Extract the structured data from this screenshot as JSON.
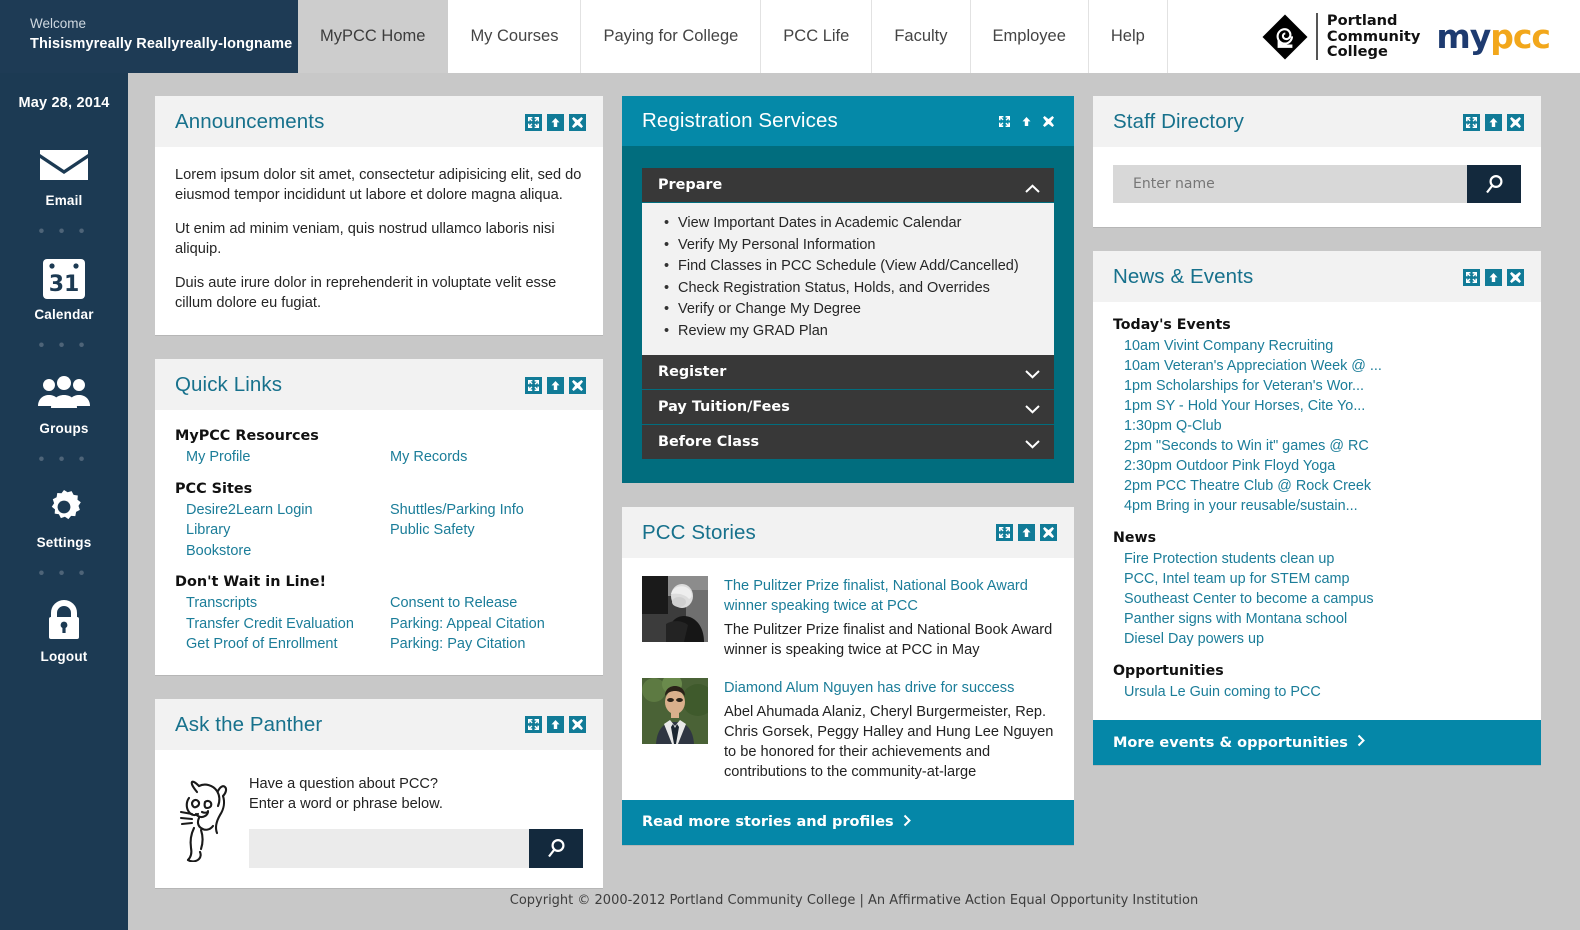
{
  "header": {
    "welcome_label": "Welcome",
    "user_name": "Thisismyreally Reallyreally-longname",
    "tabs": [
      {
        "label": "MyPCC Home",
        "active": true
      },
      {
        "label": "My Courses",
        "active": false
      },
      {
        "label": "Paying for College",
        "active": false
      },
      {
        "label": "PCC Life",
        "active": false
      },
      {
        "label": "Faculty",
        "active": false
      },
      {
        "label": "Employee",
        "active": false
      },
      {
        "label": "Help",
        "active": false
      }
    ],
    "logo": {
      "institution_line1": "Portland",
      "institution_line2": "Community",
      "institution_line3": "College",
      "wordmark_my": "my",
      "wordmark_pcc": "pcc"
    }
  },
  "sidebar": {
    "date": "May 28, 2014",
    "separator": "• • •",
    "items": [
      {
        "label": "Email",
        "icon": "envelope-icon"
      },
      {
        "label": "Calendar",
        "icon": "calendar-icon",
        "day": "31"
      },
      {
        "label": "Groups",
        "icon": "people-icon"
      },
      {
        "label": "Settings",
        "icon": "gear-icon"
      },
      {
        "label": "Logout",
        "icon": "lock-icon"
      }
    ]
  },
  "portlet_icons": {
    "expand": "expand-arrows-icon",
    "collapse": "up-arrow-icon",
    "close": "close-x-icon"
  },
  "announcements": {
    "title": "Announcements",
    "paragraphs": [
      "Lorem ipsum dolor sit amet, consectetur adipisicing elit, sed do eiusmod tempor incididunt ut labore et dolore magna aliqua.",
      "Ut enim ad minim veniam, quis nostrud ullamco laboris nisi aliquip.",
      "Duis aute irure dolor in reprehenderit in voluptate velit esse cillum dolore eu fugiat."
    ]
  },
  "quick_links": {
    "title": "Quick Links",
    "groups": [
      {
        "heading": "MyPCC Resources",
        "left": [
          "My Profile"
        ],
        "right": [
          "My Records"
        ]
      },
      {
        "heading": "PCC Sites",
        "left": [
          "Desire2Learn Login",
          "Library",
          "Bookstore"
        ],
        "right": [
          "Shuttles/Parking Info",
          "Public Safety"
        ]
      },
      {
        "heading": "Don't Wait in Line!",
        "left": [
          "Transcripts",
          "Transfer Credit Evaluation",
          "Get Proof of Enrollment"
        ],
        "right": [
          "Consent to Release",
          "Parking: Appeal Citation",
          "Parking: Pay Citation"
        ]
      }
    ]
  },
  "ask_panther": {
    "title": "Ask the Panther",
    "prompt_line1": "Have a question about PCC?",
    "prompt_line2": "Enter a word or phrase below.",
    "input_value": "",
    "input_placeholder": "",
    "search_icon": "magnifier-icon"
  },
  "registration": {
    "title": "Registration Services",
    "accordions": [
      {
        "label": "Prepare",
        "expanded": true,
        "chevron": "chevron-up-icon",
        "items": [
          "View Important Dates in Academic Calendar",
          "Verify My Personal Information",
          "Find Classes in PCC Schedule (View Add/Cancelled)",
          "Check Registration Status, Holds, and Overrides",
          "Verify or Change My Degree",
          "Review my GRAD Plan"
        ]
      },
      {
        "label": "Register",
        "expanded": false,
        "chevron": "chevron-down-icon",
        "items": []
      },
      {
        "label": "Pay Tuition/Fees",
        "expanded": false,
        "chevron": "chevron-down-icon",
        "items": []
      },
      {
        "label": "Before Class",
        "expanded": false,
        "chevron": "chevron-down-icon",
        "items": []
      }
    ]
  },
  "pcc_stories": {
    "title": "PCC Stories",
    "stories": [
      {
        "link": "The Pulitzer Prize finalist, National Book Award winner speaking twice at PCC",
        "description": "The Pulitzer Prize finalist and National Book Award winner is speaking twice at PCC in May",
        "thumbnail": "portrait-bw-photo"
      },
      {
        "link": "Diamond Alum Nguyen has drive for success",
        "description": "Abel Ahumada Alaniz, Cheryl Burgermeister, Rep. Chris Gorsek, Peggy Halley and Hung Lee Nguyen to be honored for their achievements and contributions to the community-at-large",
        "thumbnail": "portrait-suit-photo"
      }
    ],
    "footer_link": "Read more stories and profiles",
    "footer_chevron": "chevron-right-icon"
  },
  "staff_directory": {
    "title": "Staff Directory",
    "input_value": "",
    "input_placeholder": "Enter name",
    "search_icon": "magnifier-icon"
  },
  "news_events": {
    "title": "News & Events",
    "sections": [
      {
        "heading": "Today's Events",
        "items": [
          "10am Vivint Company Recruiting",
          "10am Veteran's Appreciation Week @ ...",
          "1pm Scholarships for Veteran's Wor...",
          "1pm SY - Hold Your Horses, Cite Yo...",
          "1:30pm Q-Club",
          "2pm \"Seconds to Win it\" games @ RC",
          "2:30pm Outdoor Pink Floyd Yoga",
          "2pm PCC Theatre Club @ Rock Creek",
          "4pm Bring in your reusable/sustain..."
        ]
      },
      {
        "heading": "News",
        "items": [
          "Fire Protection students clean up",
          "PCC, Intel team up for STEM camp",
          "Southeast Center to become a campus",
          "Panther signs with Montana school",
          "Diesel Day powers up"
        ]
      },
      {
        "heading": "Opportunities",
        "items": [
          "Ursula Le Guin coming to PCC"
        ]
      }
    ],
    "footer_link": "More events & opportunities",
    "footer_chevron": "chevron-right-icon"
  },
  "footer": {
    "copyright": "Copyright © 2000-2012 Portland Community College | An Affirmative Action Equal Opportunity Institution"
  },
  "colors": {
    "navy": "#1c3a53",
    "teal_header": "#0589a8",
    "teal_body": "#016d7e",
    "link_teal": "#1b7d99",
    "accordion_gray": "#383838",
    "logo_gold": "#f2a71b",
    "logo_navy": "#1e3b70"
  }
}
